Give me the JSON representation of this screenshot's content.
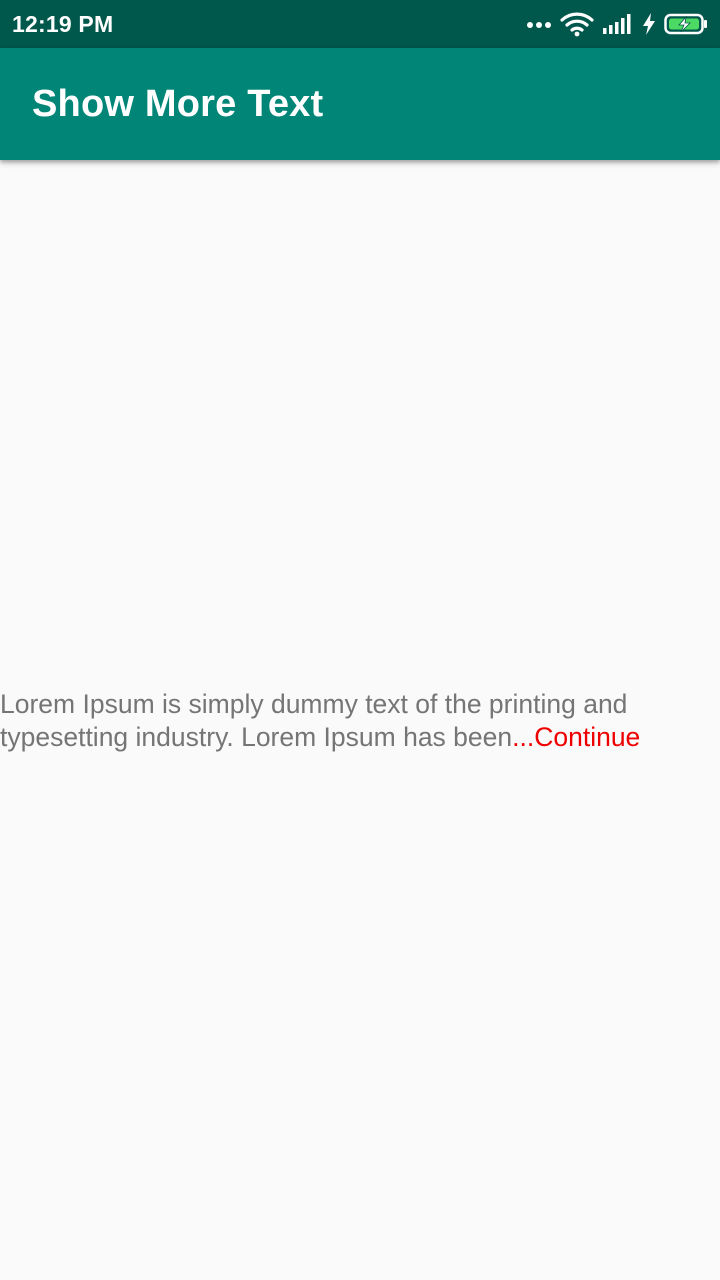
{
  "status_bar": {
    "time": "12:19 PM",
    "icons": [
      "more-dots-icon",
      "wifi-icon",
      "signal-icon",
      "charging-bolt-icon",
      "battery-icon"
    ],
    "battery_color": "#4cd964"
  },
  "app_bar": {
    "title": "Show More Text",
    "background": "#008577"
  },
  "content": {
    "text": "Lorem Ipsum is simply dummy text of the printing and\ntypesetting industry. Lorem Ipsum has been",
    "more_label": "...Continue",
    "more_color": "#ee0000",
    "text_color": "#757575"
  }
}
